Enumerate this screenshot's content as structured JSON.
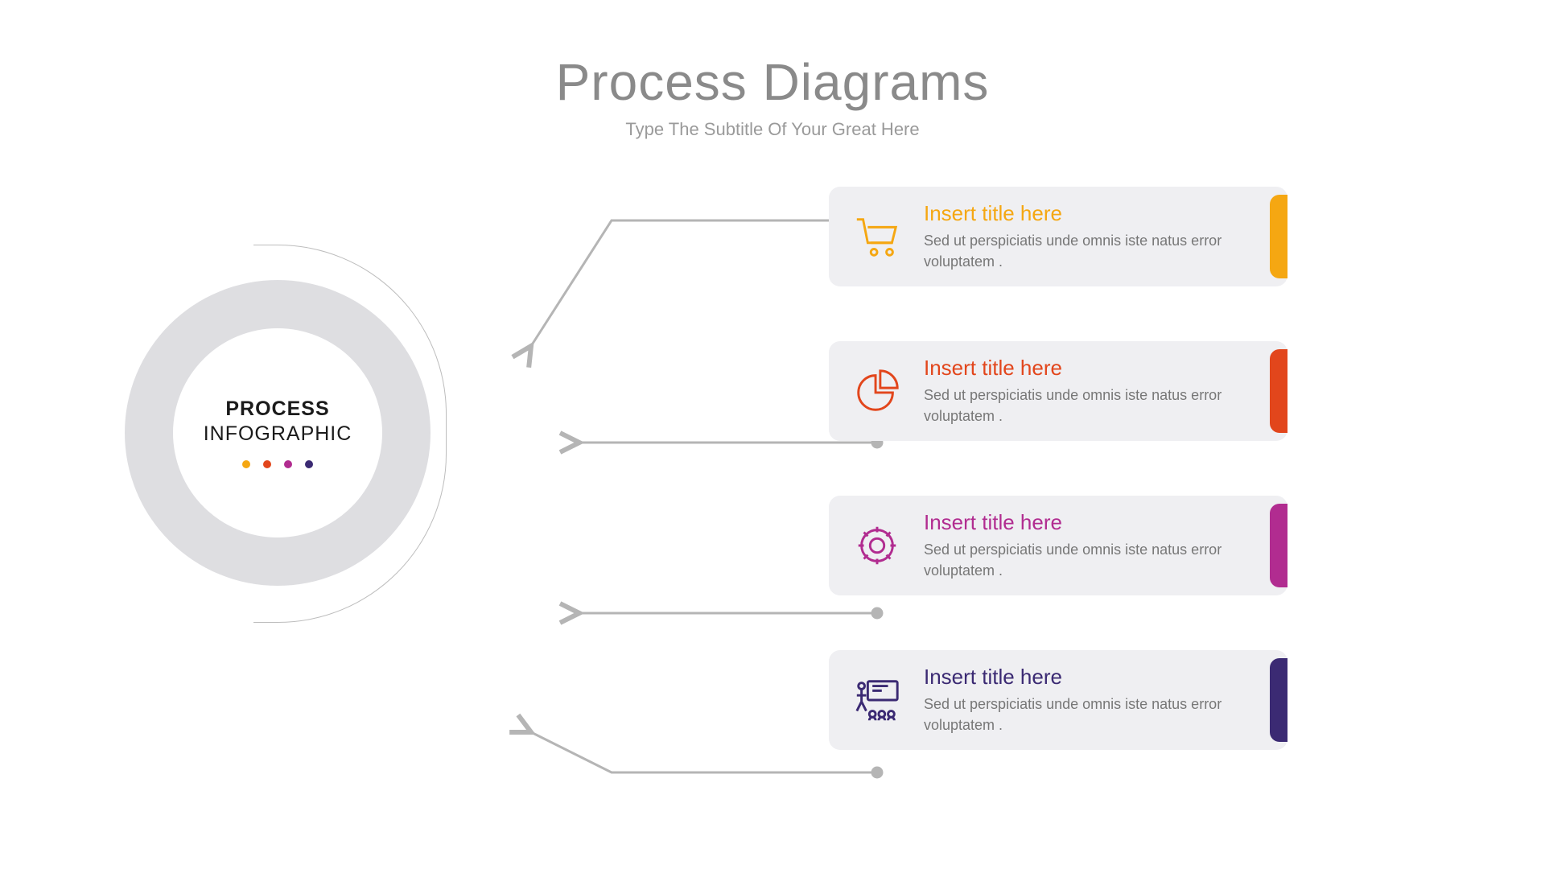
{
  "title": "Process Diagrams",
  "subtitle": "Type The Subtitle Of Your Great Here",
  "center": {
    "line1": "PROCESS",
    "line2": "INFOGRAPHIC"
  },
  "colors": {
    "c1": "#f5a712",
    "c2": "#e2461c",
    "c3": "#b12c90",
    "c4": "#3b2a73"
  },
  "items": [
    {
      "title": "Insert title here",
      "desc": "Sed ut perspiciatis unde omnis iste natus error voluptatem .",
      "color": "#f5a712",
      "icon": "cart"
    },
    {
      "title": "Insert title here",
      "desc": "Sed ut perspiciatis unde omnis iste natus error voluptatem .",
      "color": "#e2461c",
      "icon": "pie"
    },
    {
      "title": "Insert title here",
      "desc": "Sed ut perspiciatis unde omnis iste natus error voluptatem .",
      "color": "#b12c90",
      "icon": "gear"
    },
    {
      "title": "Insert title here",
      "desc": "Sed ut perspiciatis unde omnis iste natus error voluptatem .",
      "color": "#3b2a73",
      "icon": "present"
    }
  ]
}
